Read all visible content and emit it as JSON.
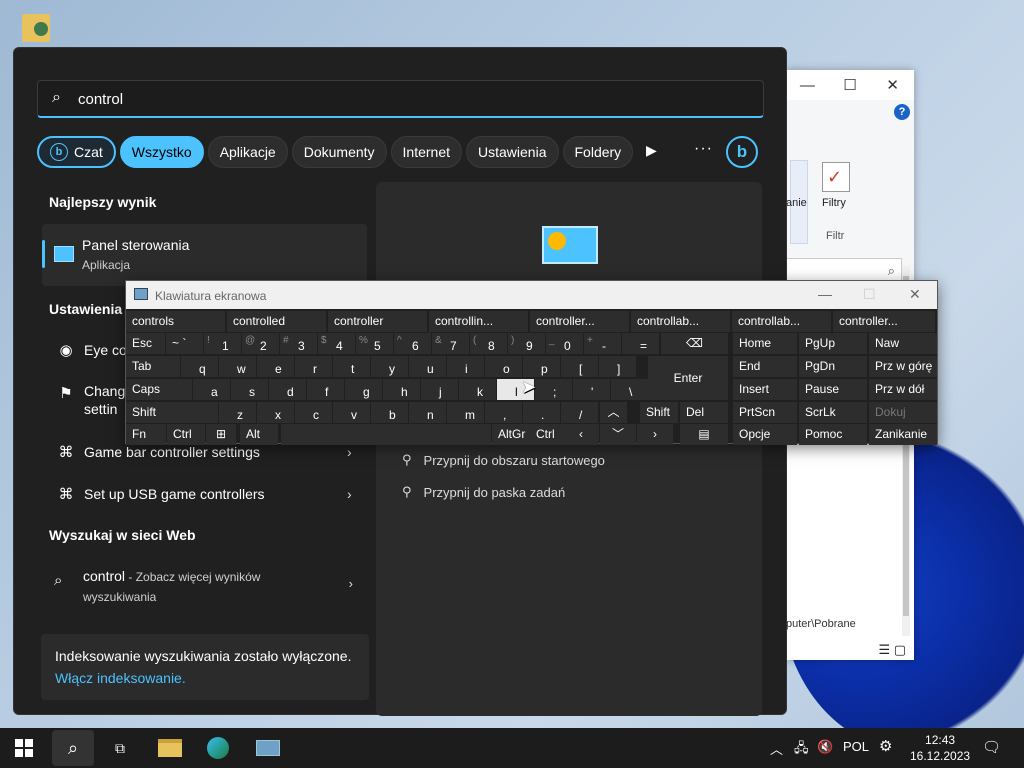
{
  "search": {
    "query": "control",
    "chips": [
      "Czat",
      "Wszystko",
      "Aplikacje",
      "Dokumenty",
      "Internet",
      "Ustawienia",
      "Foldery"
    ],
    "more_label": "···"
  },
  "best_match": {
    "heading": "Najlepszy wynik",
    "title": "Panel sterowania",
    "subtitle": "Aplikacja"
  },
  "settings": {
    "heading": "Ustawienia",
    "items": [
      "Eye co",
      "Change",
      "settin",
      "Game bar controller settings",
      "Set up USB game controllers"
    ]
  },
  "web": {
    "heading": "Wyszukaj w sieci Web",
    "query": "control",
    "hint": " - Zobacz więcej wyników",
    "hint2": "wyszukiwania"
  },
  "indexing": {
    "message": "Indeksowanie wyszukiwania zostało wyłączone.",
    "link": "Włącz indeksowanie."
  },
  "right_pane": {
    "pin_start": "Przypnij do obszaru startowego",
    "pin_taskbar": "Przypnij do paska zadań"
  },
  "osk": {
    "title": "Klawiatura ekranowa",
    "suggestions": [
      "controls",
      "controlled",
      "controller",
      "controllin...",
      "controller...",
      "controllab...",
      "controllab...",
      "controller..."
    ],
    "keys": {
      "esc": "Esc",
      "tab": "Tab",
      "caps": "Caps",
      "shift": "Shift",
      "fn": "Fn",
      "ctrl": "Ctrl",
      "alt": "Alt",
      "altgr": "AltGr",
      "ctrl_r": "Ctrl",
      "enter": "Enter",
      "shift_r": "Shift",
      "del": "Del",
      "home": "Home",
      "pgup": "PgUp",
      "naw": "Naw",
      "end": "End",
      "pgdn": "PgDn",
      "przgore": "Prz w górę",
      "insert": "Insert",
      "pause": "Pause",
      "przdol": "Prz w dół",
      "prtscn": "PrtScn",
      "scrlk": "ScrLk",
      "dokuj": "Dokuj",
      "opcje": "Opcje",
      "pomoc": "Pomoc",
      "zanikanie": "Zanikanie",
      "row1": [
        "1",
        "2",
        "3",
        "4",
        "5",
        "6",
        "7",
        "8",
        "9",
        "0",
        "-",
        "="
      ],
      "row1s": [
        "!",
        "@",
        "#",
        "$",
        "%",
        "^",
        "&",
        "(",
        ")",
        "_",
        "+",
        ""
      ],
      "row2": [
        "q",
        "w",
        "e",
        "r",
        "t",
        "y",
        "u",
        "i",
        "o",
        "p",
        "[",
        "]"
      ],
      "row3": [
        "a",
        "s",
        "d",
        "f",
        "g",
        "h",
        "j",
        "k",
        "l",
        ";",
        "'",
        "\\"
      ],
      "row4": [
        "z",
        "x",
        "c",
        "v",
        "b",
        "n",
        "m",
        ",",
        ".",
        "/"
      ]
    }
  },
  "explorer": {
    "ribbon_text": "anie",
    "filtry": "Filtry",
    "filtr_group": "Filtr",
    "path": "puter\\Pobrane"
  },
  "taskbar": {
    "language": "POL",
    "time": "12:43",
    "date": "16.12.2023"
  }
}
